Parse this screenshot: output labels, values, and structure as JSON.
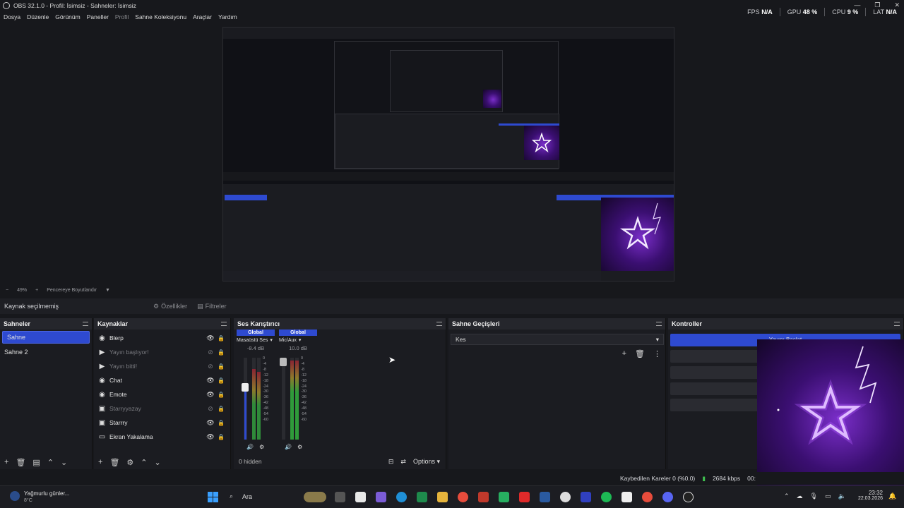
{
  "window": {
    "title": "OBS 32.1.0 - Profil: İsimsiz - Sahneler: İsimsiz",
    "controls": [
      "—",
      "❐",
      "✕"
    ]
  },
  "menu": [
    "Dosya",
    "Düzenle",
    "Görünüm",
    "Paneller",
    "Profil",
    "Sahne Koleksiyonu",
    "Araçlar",
    "Yardım"
  ],
  "stats": {
    "fps_label": "FPS",
    "fps": "N/A",
    "gpu_label": "GPU",
    "gpu": "48 %",
    "cpu_label": "CPU",
    "cpu": "9 %",
    "lat_label": "LAT",
    "lat": "N/A"
  },
  "zoombar": {
    "minus": "−",
    "zoom": "49%",
    "plus": "+",
    "fit": "Pencereye Boyutlandır"
  },
  "source_toolbar": {
    "no_source": "Kaynak seçilmemiş",
    "properties": "Özellikler",
    "filters": "Filtreler"
  },
  "scenes": {
    "title": "Sahneler",
    "items": [
      "Sahne",
      "Sahne 2"
    ],
    "selected": 0
  },
  "sources": {
    "title": "Kaynaklar",
    "items": [
      {
        "name": "Blerp",
        "icon": "browser-icon",
        "dim": false
      },
      {
        "name": "Yayın başlıyor!",
        "icon": "media-icon",
        "dim": true
      },
      {
        "name": "Yayın bitti!",
        "icon": "media-icon",
        "dim": true
      },
      {
        "name": "Chat",
        "icon": "browser-icon",
        "dim": false
      },
      {
        "name": "Emote",
        "icon": "browser-icon",
        "dim": false
      },
      {
        "name": "Starryyazay",
        "icon": "image-icon",
        "dim": true
      },
      {
        "name": "Starrry",
        "icon": "image-icon",
        "dim": false
      },
      {
        "name": "Ekran Yakalama",
        "icon": "display-icon",
        "dim": false
      }
    ]
  },
  "mixer": {
    "title": "Ses Karıştırıcı",
    "channels": [
      {
        "global": "Global",
        "name": "Masaüstü Ses",
        "db": "-8.4 dB"
      },
      {
        "global": "Global",
        "name": "Mic/Aux",
        "db": "10.0 dB"
      }
    ],
    "scale": [
      "0",
      "-4",
      "-8",
      "-12",
      "-18",
      "-24",
      "-30",
      "-36",
      "-42",
      "-48",
      "-54",
      "-60"
    ],
    "hidden": "0 hidden",
    "options": "Options"
  },
  "transitions": {
    "title": "Sahne Geçişleri",
    "selected": "Kes"
  },
  "controls": {
    "title": "Kontroller",
    "buttons": [
      "Yayını Başlat",
      "",
      "Sahne",
      "",
      ""
    ]
  },
  "status": {
    "dropped": "Kaybedilen Kareler 0 (%0.0)",
    "bitrate": "2684 kbps",
    "time": "00:"
  },
  "taskbar": {
    "weather": "Yağmurlu günler...",
    "temp": "8°C",
    "search": "Ara",
    "time": "23:32",
    "date": "22.03.2026"
  },
  "colors": {
    "accent": "#2e4ad0",
    "panel": "#1b1c21",
    "bg": "#17181c"
  }
}
